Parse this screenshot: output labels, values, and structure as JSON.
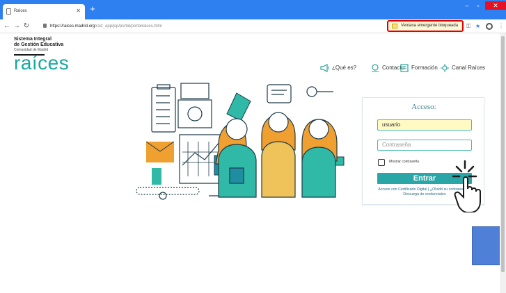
{
  "browser": {
    "tab_title": "Raíces",
    "new_tab": "+",
    "url_host": "https://raices.madrid.org",
    "url_path": "/raiz_app/jsp/portal/portalraices.html",
    "popup_blocked": "Ventana emergente bloqueada"
  },
  "brand": {
    "line1": "Sistema Integral",
    "line2": "de Gestión Educativa",
    "line3": "Comunidad de Madrid",
    "logo": "raíces"
  },
  "nav": {
    "que_es": "¿Qué es?",
    "contacto": "Contacto",
    "formacion": "Formación",
    "canal": "Canal Raíces"
  },
  "login": {
    "title": "Acceso:",
    "username_value": "usuario",
    "password_placeholder": "Contraseña",
    "show_password": "Mostrar contraseña",
    "submit": "Entrar",
    "links_line1": "Acceso con Certificado Digital | ¿Olvidó su contraseña? |",
    "links_line2": "Descarga de credenciales"
  },
  "colors": {
    "accent": "#18a8a0",
    "button": "#2ba6a6",
    "chrome": "#2e7ff0",
    "highlight_border": "#e00000"
  },
  "icons": [
    "tab-page-icon",
    "back-icon",
    "forward-icon",
    "reload-icon",
    "lock-icon",
    "popup-blocked-icon",
    "key-icon",
    "star-icon",
    "profile-icon",
    "menu-icon",
    "megaphone-icon",
    "contact-icon",
    "training-icon",
    "channel-icon",
    "click-hand-icon"
  ]
}
